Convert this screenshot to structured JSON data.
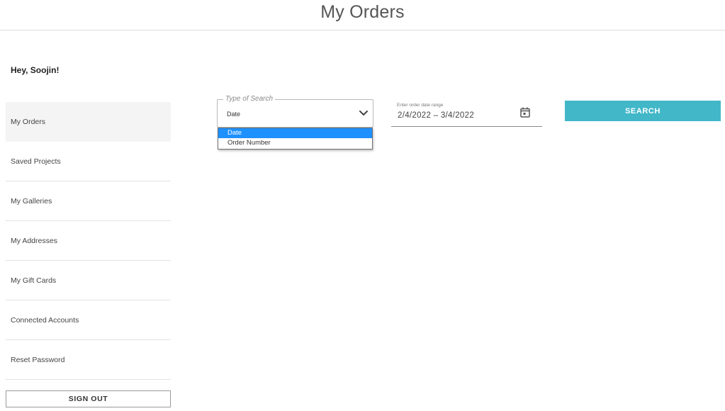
{
  "header": {
    "title": "My Orders"
  },
  "greeting": "Hey, Soojin!",
  "sidebar": {
    "items": [
      {
        "label": "My Orders",
        "active": true
      },
      {
        "label": "Saved Projects",
        "active": false
      },
      {
        "label": "My Galleries",
        "active": false
      },
      {
        "label": "My Addresses",
        "active": false
      },
      {
        "label": "My Gift Cards",
        "active": false
      },
      {
        "label": "Connected Accounts",
        "active": false
      },
      {
        "label": "Reset Password",
        "active": false
      }
    ],
    "signout_label": "SIGN OUT"
  },
  "search": {
    "type_label": "Type of Search",
    "type_value": "Date",
    "options": [
      {
        "label": "Date",
        "selected": true
      },
      {
        "label": "Order Number",
        "selected": false
      }
    ],
    "date_label": "Enter order date range",
    "date_value": "2/4/2022 – 3/4/2022",
    "button_label": "SEARCH",
    "button_color": "#41b7c8",
    "icons": {
      "select": "chevron-down-icon",
      "date": "calendar-icon"
    }
  }
}
